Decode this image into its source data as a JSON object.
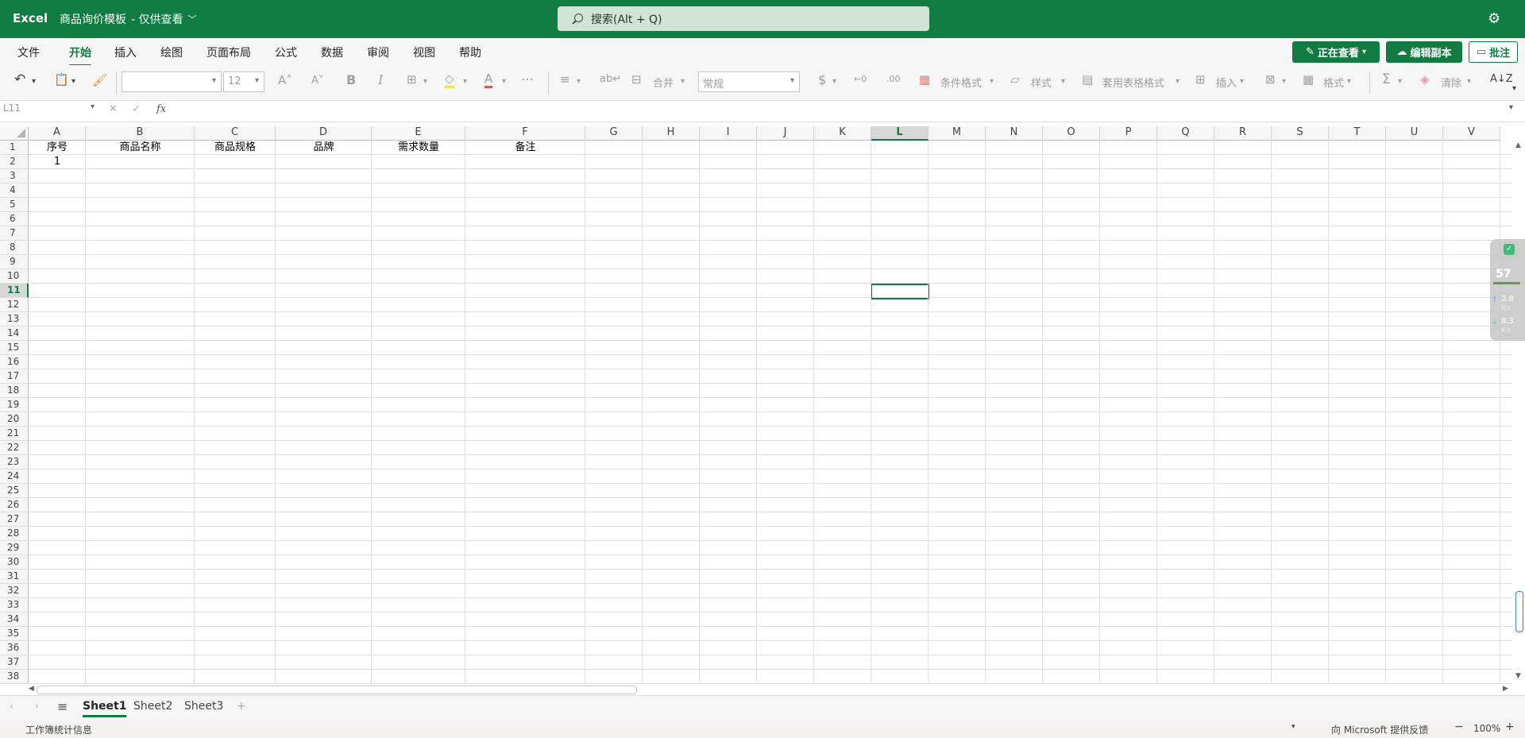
{
  "titlebar": {
    "app_name": "Excel",
    "doc_title": "商品询价模板",
    "doc_mode": "- 仅供查看",
    "search_placeholder": "搜索(Alt + Q)",
    "settings_icon": "gear-icon"
  },
  "menu": {
    "items": [
      "文件",
      "开始",
      "插入",
      "绘图",
      "页面布局",
      "公式",
      "数据",
      "审阅",
      "视图",
      "帮助"
    ],
    "active": "开始"
  },
  "actions": {
    "viewing_label": "正在查看",
    "edit_copy_label": "编辑副本",
    "comment_label": "批注"
  },
  "ribbon": {
    "font_name": "",
    "font_size": "12",
    "number_format": "常规",
    "merge_label": "合并",
    "cond_format_label": "条件格式",
    "styles_label": "样式",
    "table_format_label": "套用表格格式",
    "insert_label": "插入",
    "format_label": "格式",
    "clear_label": "清除"
  },
  "formula_bar": {
    "name_box": "L11",
    "fx_label": "fx",
    "formula": ""
  },
  "sheet": {
    "columns": [
      "A",
      "B",
      "C",
      "D",
      "E",
      "F",
      "G",
      "H",
      "I",
      "J",
      "K",
      "L",
      "M",
      "N",
      "O",
      "P",
      "Q",
      "R",
      "S",
      "T",
      "U",
      "V"
    ],
    "selected_column": "L",
    "rows": [
      "1",
      "2",
      "3",
      "4",
      "5",
      "6",
      "7",
      "8",
      "9",
      "10",
      "11",
      "12",
      "13",
      "14",
      "15",
      "16",
      "17",
      "18",
      "19",
      "20",
      "21",
      "22",
      "23",
      "24",
      "25",
      "26",
      "27",
      "28",
      "29",
      "30",
      "31",
      "32",
      "33",
      "34",
      "35",
      "36",
      "37",
      "38"
    ],
    "selected_row": "11",
    "header_row": [
      "序号",
      "商品名称",
      "商品规格",
      "品牌",
      "需求数量",
      "备注"
    ],
    "row2_a": "1"
  },
  "sheet_tabs": {
    "tabs": [
      "Sheet1",
      "Sheet2",
      "Sheet3"
    ],
    "active": "Sheet1",
    "add_label": "+"
  },
  "status": {
    "left_text": "工作簿统计信息",
    "feedback": "向 Microsoft 提供反馈",
    "zoom": "100%",
    "zoom_minus": "−",
    "zoom_plus": "+"
  },
  "overlay_widget": {
    "percent": "57",
    "upload": "3.8",
    "download": "8.3",
    "unit": "K/s"
  },
  "colors": {
    "brand": "#107c41",
    "search_bg": "#cfe3d6"
  }
}
